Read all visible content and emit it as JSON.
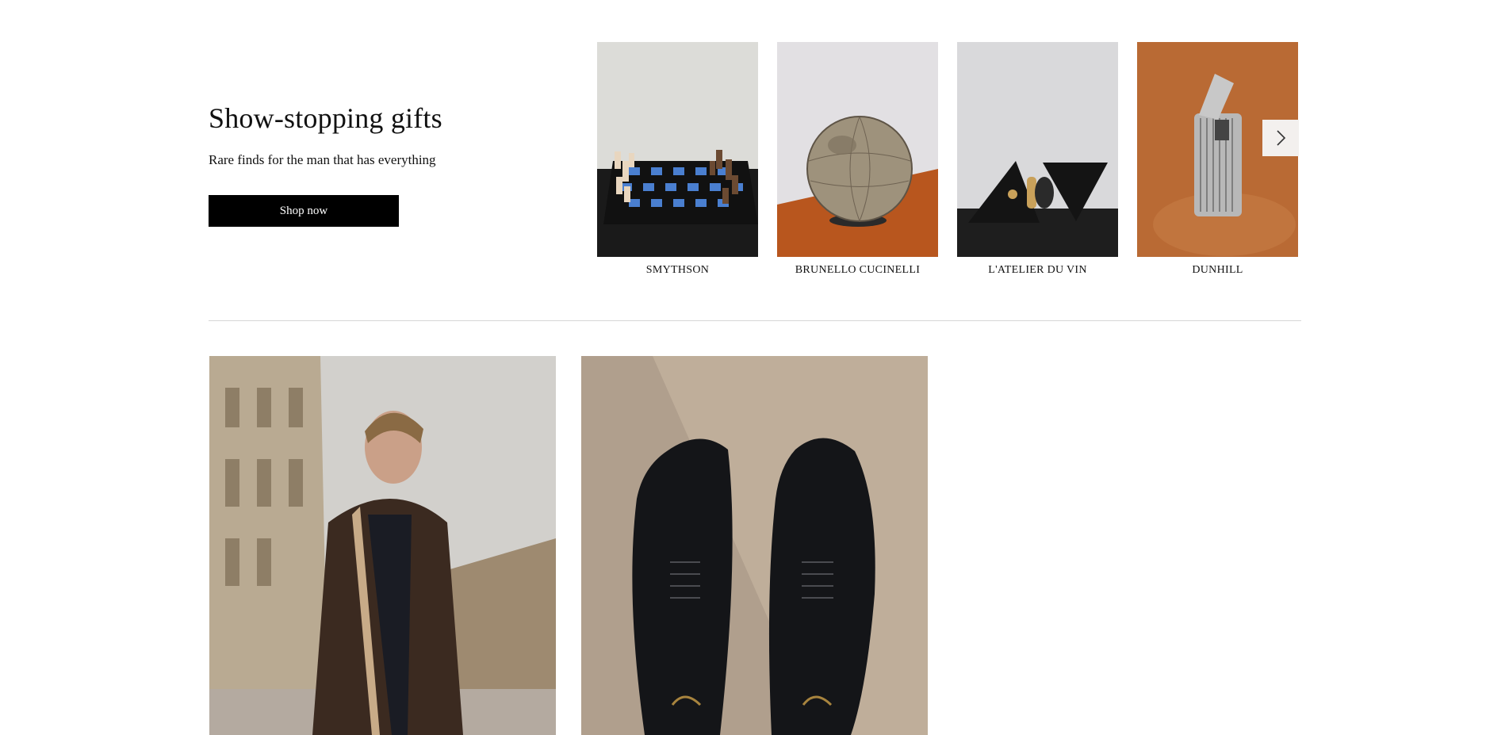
{
  "promo": {
    "title": "Show-stopping gifts",
    "subtitle": "Rare finds for the man that has everything",
    "cta_label": "Shop now"
  },
  "carousel": {
    "items": [
      {
        "brand": "SMYTHSON",
        "image": "chess-set"
      },
      {
        "brand": "BRUNELLO CUCINELLI",
        "image": "globe"
      },
      {
        "brand": "L'ATELIER DU VIN",
        "image": "wine-tool-set"
      },
      {
        "brand": "DUNHILL",
        "image": "lighter"
      }
    ],
    "next_icon": "chevron-right-icon"
  },
  "editorial": {
    "tiles": [
      {
        "image": "man-in-leather-coat"
      },
      {
        "image": "black-oxford-shoes"
      }
    ]
  },
  "colors": {
    "button_bg": "#000000",
    "button_text": "#ffffff",
    "divider": "#d6d6d6",
    "arrow_bg": "#f3f0ee"
  }
}
